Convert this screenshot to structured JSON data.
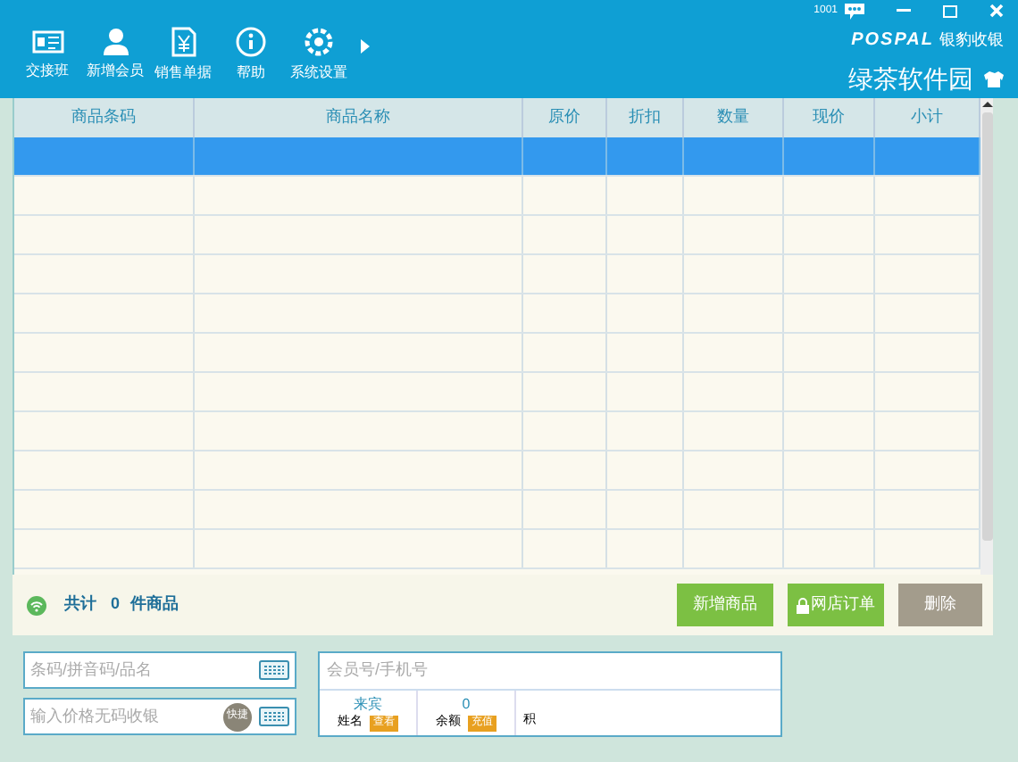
{
  "toolbar": [
    {
      "label": "交接班"
    },
    {
      "label": "新增会员"
    },
    {
      "label": "销售单据"
    },
    {
      "label": "帮助"
    },
    {
      "label": "系统设置"
    }
  ],
  "top_right": {
    "badge": "1001",
    "logo": "POSPAL",
    "brand": "银豹收银",
    "store": "绿茶软件园"
  },
  "table": {
    "columns": [
      "商品条码",
      "商品名称",
      "原价",
      "折扣",
      "数量",
      "现价",
      "小计"
    ],
    "rows": [
      {
        "selected": true
      },
      {
        "selected": false
      },
      {
        "selected": false
      },
      {
        "selected": false
      },
      {
        "selected": false
      },
      {
        "selected": false
      },
      {
        "selected": false
      },
      {
        "selected": false
      },
      {
        "selected": false
      },
      {
        "selected": false
      },
      {
        "selected": false
      }
    ]
  },
  "summary": {
    "label": "共计",
    "count": "0",
    "unit": "件商品"
  },
  "actions": [
    {
      "label": "新增商品",
      "kind": "green"
    },
    {
      "label": "网店订单",
      "kind": "lock"
    },
    {
      "label": "删除",
      "kind": "grey"
    }
  ],
  "search": {
    "placeholder": "条码/拼音码/品名"
  },
  "price_input": {
    "placeholder": "输入价格无码收银",
    "button": "快捷"
  },
  "member": {
    "placeholder": "会员号/手机号",
    "name_value": "来宾",
    "name_label": "姓名",
    "name_button": "查看",
    "balance_value": "0",
    "balance_label": "余额",
    "balance_button": "充值",
    "points_label": "积"
  }
}
